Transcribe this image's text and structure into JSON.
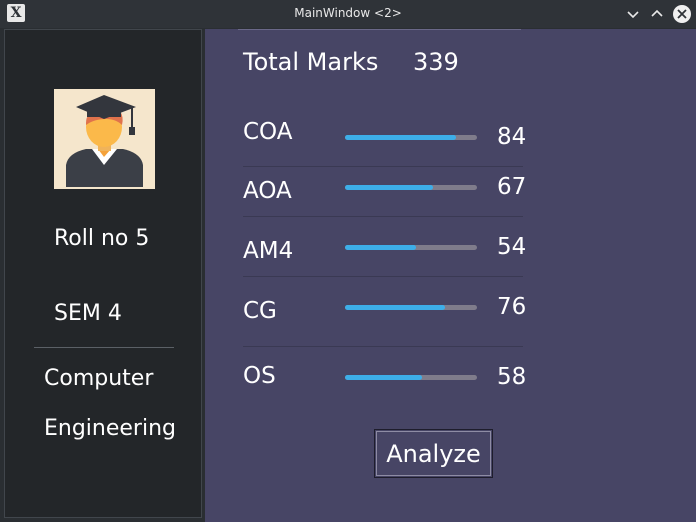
{
  "window": {
    "title": "MainWindow <2>"
  },
  "sidebar": {
    "roll": "Roll no 5",
    "sem": "SEM 4",
    "dept_line1": "Computer",
    "dept_line2": "Engineering"
  },
  "main": {
    "total_label": "Total Marks",
    "total_value": "339",
    "subjects": [
      {
        "name": "COA",
        "value": "84",
        "progress": 0.84
      },
      {
        "name": "AOA",
        "value": "67",
        "progress": 0.67
      },
      {
        "name": "AM4",
        "value": "54",
        "progress": 0.54
      },
      {
        "name": "CG",
        "value": "76",
        "progress": 0.76
      },
      {
        "name": "OS",
        "value": "58",
        "progress": 0.58
      }
    ],
    "analyze_label": "Analyze"
  },
  "colors": {
    "accent": "#3daee9",
    "panel": "#474565",
    "sidebar": "#232629"
  },
  "icons": [
    "app-icon",
    "minimize-icon",
    "maximize-icon",
    "close-icon",
    "graduate-avatar-icon"
  ]
}
